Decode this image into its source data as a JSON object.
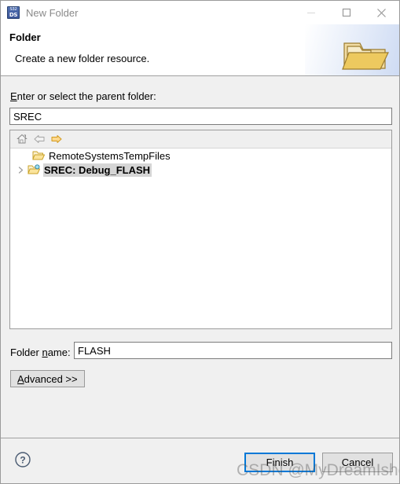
{
  "window": {
    "title": "New Folder",
    "icon_name": "s32ds-app-icon",
    "icon_line1": "S32",
    "icon_line2": "DS",
    "minimize_label": "Minimize",
    "maximize_label": "Maximize",
    "close_label": "Close"
  },
  "header": {
    "title": "Folder",
    "description": "Create a new folder resource.",
    "image_name": "folder-banner-image"
  },
  "form": {
    "parent_label_prefix": "E",
    "parent_label_rest": "nter or select the parent folder:",
    "parent_value": "SREC",
    "folder_name_label_a": "Folder ",
    "folder_name_label_mn": "n",
    "folder_name_label_b": "ame:",
    "folder_name_value": "FLASH",
    "advanced_mn": "A",
    "advanced_rest": "dvanced >>"
  },
  "tree": {
    "toolbar": [
      {
        "name": "home-icon",
        "title": "Home",
        "enabled": false
      },
      {
        "name": "back-arrow-icon",
        "title": "Back",
        "enabled": false
      },
      {
        "name": "forward-arrow-icon",
        "title": "Forward",
        "enabled": true
      }
    ],
    "items": [
      {
        "label": "RemoteSystemsTempFiles",
        "icon": "open-folder-icon",
        "expandable": false,
        "selected": false,
        "indent": 21
      },
      {
        "label": "SREC: Debug_FLASH",
        "icon": "open-folder-linked-icon",
        "expandable": true,
        "selected": true,
        "indent": 0
      }
    ]
  },
  "footer": {
    "help_label": "?",
    "finish_label": "Finish",
    "cancel_label": "Cancel"
  },
  "watermark": {
    "text": "CSDN @MyDreamIsher"
  },
  "colors": {
    "accent": "#0078d7",
    "dialog_bg": "#f0f0f0",
    "header_bg": "#ffffff",
    "title_text": "#8a8a8a",
    "folder_yellow": "#e8c56a",
    "selection": "#d5d5d5"
  }
}
